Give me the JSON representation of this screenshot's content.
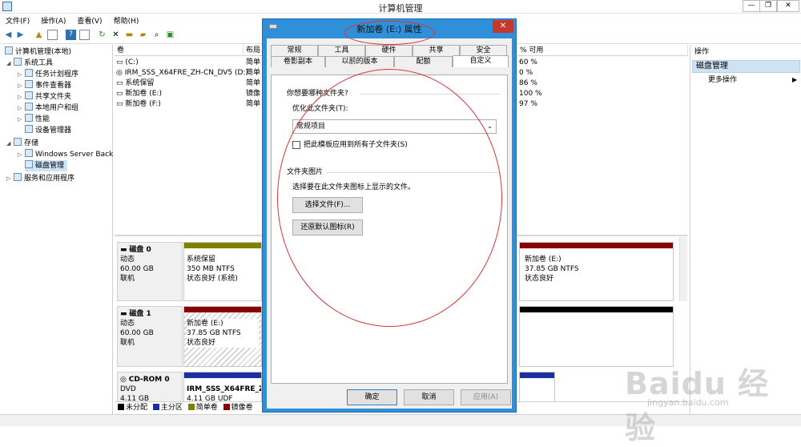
{
  "window": {
    "title": "计算机管理",
    "controls": [
      "—",
      "❐",
      "✕"
    ]
  },
  "menu": [
    "文件(F)",
    "操作(A)",
    "查看(V)",
    "帮助(H)"
  ],
  "tree": [
    {
      "label": "计算机管理(本地)",
      "level": 0,
      "arrow": ""
    },
    {
      "label": "系统工具",
      "level": 1,
      "arrow": "◢"
    },
    {
      "label": "任务计划程序",
      "level": 2,
      "arrow": "▷"
    },
    {
      "label": "事件查看器",
      "level": 2,
      "arrow": "▷"
    },
    {
      "label": "共享文件夹",
      "level": 2,
      "arrow": "▷"
    },
    {
      "label": "本地用户和组",
      "level": 2,
      "arrow": "▷"
    },
    {
      "label": "性能",
      "level": 2,
      "arrow": "▷"
    },
    {
      "label": "设备管理器",
      "level": 2,
      "arrow": ""
    },
    {
      "label": "存储",
      "level": 1,
      "arrow": "◢"
    },
    {
      "label": "Windows Server Back",
      "level": 2,
      "arrow": "▷"
    },
    {
      "label": "磁盘管理",
      "level": 2,
      "arrow": ""
    },
    {
      "label": "服务和应用程序",
      "level": 1,
      "arrow": "▷"
    }
  ],
  "volume_list": {
    "headers": [
      "卷",
      "布局",
      "% 可用"
    ],
    "rows": [
      {
        "name": "(C:)",
        "layout": "简单",
        "free": "60 %"
      },
      {
        "name": "IRM_SSS_X64FRE_ZH-CN_DV5 (D:)",
        "layout": "简单",
        "free": "0 %"
      },
      {
        "name": "系统保留",
        "layout": "简单",
        "free": "86 %"
      },
      {
        "name": "新加卷 (E:)",
        "layout": "镜像",
        "free": "100 %"
      },
      {
        "name": "新加卷 (F:)",
        "layout": "简单",
        "free": "97 %"
      }
    ]
  },
  "disks": [
    {
      "name": "磁盘 0",
      "type": "动态",
      "size": "60.00 GB",
      "status": "联机",
      "parts": [
        {
          "name": "系统保留",
          "size": "350 MB NTFS",
          "status": "状态良好 (系统)"
        },
        {
          "name": "新加卷 (E:)",
          "size": "37.85 GB NTFS",
          "status": "状态良好"
        }
      ]
    },
    {
      "name": "磁盘 1",
      "type": "动态",
      "size": "60.00 GB",
      "status": "联机",
      "parts": [
        {
          "name": "新加卷 (E:)",
          "size": "37.85 GB NTFS",
          "status": "状态良好"
        }
      ]
    },
    {
      "name": "CD-ROM 0",
      "type": "DVD",
      "size": "4.11 GB",
      "status": "",
      "parts": [
        {
          "name": "IRM_SSS_X64FRE_ZH-",
          "size": "4.11 GB UDF",
          "status": ""
        }
      ]
    }
  ],
  "legend": [
    {
      "label": "未分配",
      "color": "#000000"
    },
    {
      "label": "主分区",
      "color": "#1a2fa0"
    },
    {
      "label": "简单卷",
      "color": "#808000"
    },
    {
      "label": "镜像卷",
      "color": "#8b0000"
    }
  ],
  "actions": {
    "header": "操作",
    "section": "磁盘管理",
    "item": "更多操作"
  },
  "dialog": {
    "title": "新加卷 (E:) 属性",
    "tabs_row1": [
      "常规",
      "工具",
      "硬件",
      "共享",
      "安全"
    ],
    "tabs_row2": [
      "卷影副本",
      "以前的版本",
      "配额",
      "自定义"
    ],
    "question": "你想要哪种文件夹?",
    "optimize_label": "优化此文件夹(T):",
    "optimize_value": "常规项目",
    "apply_sub": "把此模板应用到所有子文件夹(S)",
    "pictures_title": "文件夹图片",
    "pictures_desc": "选择要在此文件夹图标上显示的文件。",
    "choose_file": "选择文件(F)...",
    "restore_icon": "还原默认图标(R)",
    "ok": "确定",
    "cancel": "取消",
    "apply": "应用(A)"
  },
  "watermark": {
    "logo": "Baidu 经验",
    "url": "jingyan.baidu.com"
  },
  "colors": {
    "accent": "#2f8fd8",
    "simple": "#808000",
    "mirror": "#8b0000",
    "primary": "#1a2fa0",
    "annotation": "#dd3333"
  }
}
